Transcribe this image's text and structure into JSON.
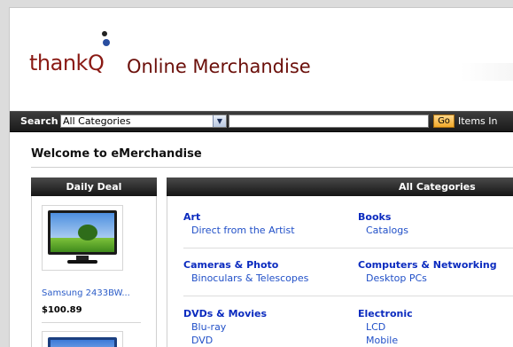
{
  "header": {
    "logo_text": "thankQ",
    "site_title": "Online Merchandise"
  },
  "search": {
    "label": "Search",
    "category_selected": "All Categories",
    "query": "",
    "go_label": "Go",
    "items_label": "Items In"
  },
  "welcome": "Welcome to eMerchandise",
  "daily_deal": {
    "title": "Daily Deal",
    "items": [
      {
        "name": "Samsung 2433BW...",
        "price": "$100.89"
      }
    ]
  },
  "categories": {
    "title": "All Categories",
    "groups": [
      {
        "title": "Art",
        "links": [
          "Direct from the Artist"
        ]
      },
      {
        "title": "Books",
        "links": [
          "Catalogs"
        ]
      },
      {
        "title": "Cameras & Photo",
        "links": [
          "Binoculars & Telescopes"
        ]
      },
      {
        "title": "Computers & Networking",
        "links": [
          "Desktop PCs"
        ]
      },
      {
        "title": "DVDs & Movies",
        "links": [
          "Blu-ray",
          "DVD"
        ]
      },
      {
        "title": "Electronic",
        "links": [
          "LCD",
          "Mobile"
        ]
      }
    ]
  },
  "colors": {
    "brand": "#8a1a14",
    "category_title": "#0b2bbf",
    "link": "#2150c8",
    "go_button": "#f1a92a"
  }
}
